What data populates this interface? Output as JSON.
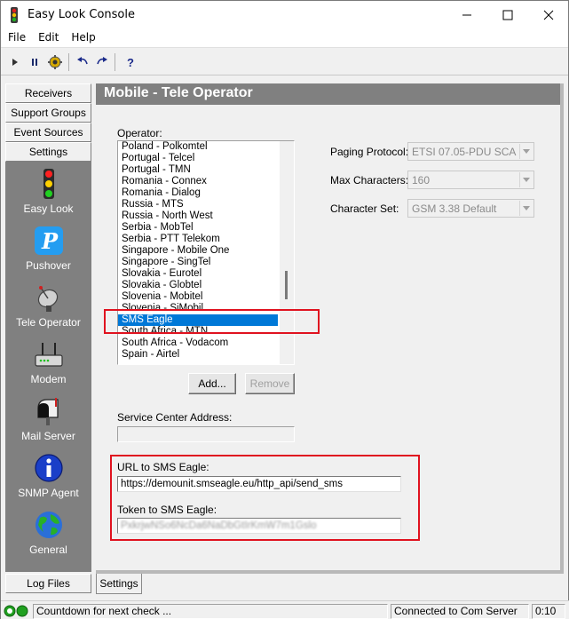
{
  "window": {
    "title": "Easy Look Console"
  },
  "menu": {
    "file": "File",
    "edit": "Edit",
    "help": "Help"
  },
  "nav": {
    "top_buttons": [
      "Receivers",
      "Support Groups",
      "Event Sources",
      "Settings"
    ],
    "icons": [
      {
        "label": "Easy Look",
        "icon": "traffic-light-icon"
      },
      {
        "label": "Pushover",
        "icon": "pushover-icon"
      },
      {
        "label": "Tele Operator",
        "icon": "satellite-dish-icon"
      },
      {
        "label": "Modem",
        "icon": "modem-icon"
      },
      {
        "label": "Mail Server",
        "icon": "mailbox-icon"
      },
      {
        "label": "SNMP Agent",
        "icon": "info-icon"
      },
      {
        "label": "General",
        "icon": "globe-icon"
      }
    ],
    "log_files": "Log Files"
  },
  "panel": {
    "title": "Mobile - Tele Operator",
    "operator_label": "Operator:",
    "operators": [
      "Poland - Polkomtel",
      "Portugal - Telcel",
      "Portugal - TMN",
      "Romania - Connex",
      "Romania - Dialog",
      "Russia - MTS",
      "Russia - North West",
      "Serbia - MobTel",
      "Serbia - PTT Telekom",
      "Singapore - Mobile One",
      "Singapore - SingTel",
      "Slovakia - Eurotel",
      "Slovakia - Globtel",
      "Slovenia - Mobitel",
      "Slovenia - SiMobil",
      "SMS Eagle",
      "South Africa - MTN",
      "South Africa - Vodacom",
      "Spain - Airtel"
    ],
    "selected_operator": "SMS Eagle",
    "add_button": "Add...",
    "remove_button": "Remove",
    "paging_protocol_label": "Paging Protocol:",
    "paging_protocol_value": "ETSI 07.05-PDU SCA",
    "max_characters_label": "Max Characters:",
    "max_characters_value": "160",
    "character_set_label": "Character Set:",
    "character_set_value": "GSM 3.38 Default",
    "service_center_label": "Service Center Address:",
    "service_center_value": "",
    "url_label": "URL to SMS Eagle:",
    "url_value": "https://demounit.smseagle.eu/http_api/send_sms",
    "token_label": "Token to SMS Eagle:",
    "token_value": "PxkrjwNSo6NcDa6NaDbGtIrKmW7m1Gslo"
  },
  "tabs": {
    "settings": "Settings"
  },
  "status": {
    "countdown": "Countdown for next check ...",
    "connection": "Connected to Com Server",
    "time": "0:10"
  },
  "colors": {
    "selection": "#0078d7",
    "header_bg": "#808080",
    "highlight_box": "#e0121f"
  }
}
